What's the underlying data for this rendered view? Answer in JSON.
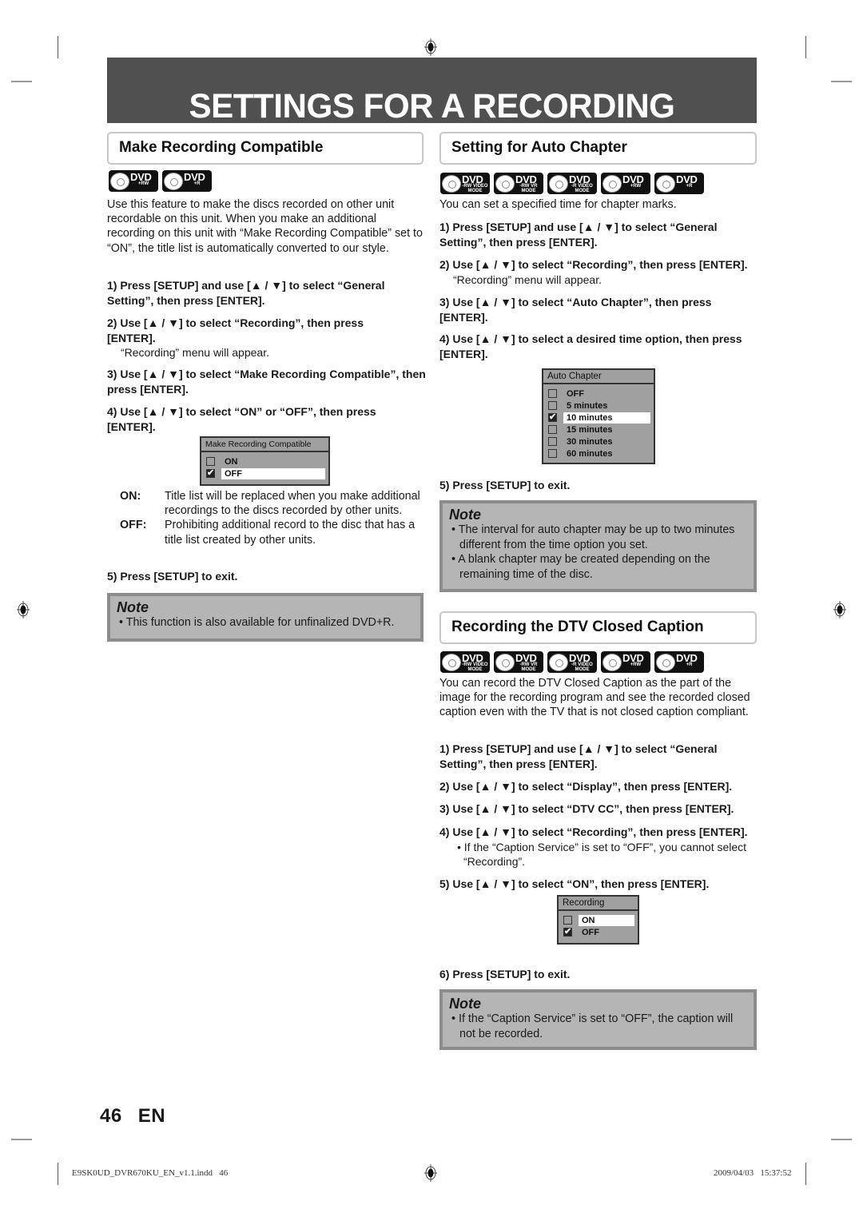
{
  "page": {
    "title": "SETTINGS FOR A RECORDING",
    "page_number": "46",
    "language": "EN"
  },
  "sections": {
    "make_compatible": {
      "heading": "Make Recording Compatible",
      "badges": [
        {
          "label": "DVD",
          "sub": "+RW"
        },
        {
          "label": "DVD",
          "sub": "+R"
        }
      ],
      "intro": "Use this feature to make the discs recorded on other unit recordable on this unit. When you make an additional recording on this unit with “Make Recording Compatible” set to “ON”, the title list is automatically converted to our style.",
      "steps": [
        {
          "num": "1)",
          "text": "Press [SETUP] and use [▲ / ▼] to select “General Setting”, then press [ENTER]."
        },
        {
          "num": "2)",
          "text": "Use [▲ / ▼] to select “Recording”, then press [ENTER].",
          "detail": "“Recording” menu will appear."
        },
        {
          "num": "3)",
          "text": "Use [▲ / ▼] to select “Make Recording Compatible”, then press [ENTER]."
        },
        {
          "num": "4)",
          "text": "Use [▲ / ▼] to select “ON” or “OFF”, then press [ENTER]."
        },
        {
          "num": "5)",
          "text": "Press [SETUP] to exit."
        }
      ],
      "osd": {
        "title": "Make Recording Compatible",
        "options": [
          {
            "label": "ON",
            "checked": false,
            "highlighted": false
          },
          {
            "label": "OFF",
            "checked": true,
            "highlighted": true
          }
        ]
      },
      "definitions": [
        {
          "term": "ON:",
          "desc": "Title list will be replaced when you make additional recordings to the discs recorded by other units."
        },
        {
          "term": "OFF:",
          "desc": "Prohibiting additional record to the disc that has a title list created by other units."
        }
      ],
      "note": {
        "title": "Note",
        "items": [
          "This function is also available for unfinalized DVD+R."
        ]
      }
    },
    "auto_chapter": {
      "heading": "Setting for Auto Chapter",
      "badges": [
        {
          "label": "DVD",
          "sub": "-RW VIDEO MODE"
        },
        {
          "label": "DVD",
          "sub": "-RW VR MODE"
        },
        {
          "label": "DVD",
          "sub": "-R VIDEO MODE"
        },
        {
          "label": "DVD",
          "sub": "+RW"
        },
        {
          "label": "DVD",
          "sub": "+R"
        }
      ],
      "intro": "You can set a specified time for chapter marks.",
      "steps": [
        {
          "num": "1)",
          "text": "Press [SETUP] and use [▲ / ▼] to select “General Setting”, then press [ENTER]."
        },
        {
          "num": "2)",
          "text": "Use [▲ / ▼] to select “Recording”, then press [ENTER].",
          "detail": "“Recording” menu will appear."
        },
        {
          "num": "3)",
          "text": "Use [▲ / ▼] to select “Auto Chapter”, then press [ENTER]."
        },
        {
          "num": "4)",
          "text": "Use [▲ / ▼] to select a desired time option, then press [ENTER]."
        },
        {
          "num": "5)",
          "text": "Press [SETUP] to exit."
        }
      ],
      "osd": {
        "title": "Auto Chapter",
        "options": [
          {
            "label": "OFF",
            "checked": false,
            "highlighted": false
          },
          {
            "label": "5 minutes",
            "checked": false,
            "highlighted": false
          },
          {
            "label": "10 minutes",
            "checked": true,
            "highlighted": true
          },
          {
            "label": "15 minutes",
            "checked": false,
            "highlighted": false
          },
          {
            "label": "30 minutes",
            "checked": false,
            "highlighted": false
          },
          {
            "label": "60 minutes",
            "checked": false,
            "highlighted": false
          }
        ]
      },
      "note": {
        "title": "Note",
        "items": [
          "The interval for auto chapter may be up to two minutes different from the time option you set.",
          "A blank chapter may be created depending on the remaining time of the disc."
        ]
      }
    },
    "dtv_cc": {
      "heading": "Recording the DTV Closed Caption",
      "badges": [
        {
          "label": "DVD",
          "sub": "-RW VIDEO MODE"
        },
        {
          "label": "DVD",
          "sub": "-RW VR MODE"
        },
        {
          "label": "DVD",
          "sub": "-R VIDEO MODE"
        },
        {
          "label": "DVD",
          "sub": "+RW"
        },
        {
          "label": "DVD",
          "sub": "+R"
        }
      ],
      "intro": "You can record the DTV Closed Caption as the part of the image for the recording program and see the recorded closed caption even with the TV that is not closed caption compliant.",
      "steps": [
        {
          "num": "1)",
          "text": "Press [SETUP] and use [▲ / ▼] to select “General Setting”, then press [ENTER]."
        },
        {
          "num": "2)",
          "text": "Use [▲ / ▼] to select “Display”, then press [ENTER]."
        },
        {
          "num": "3)",
          "text": "Use [▲ / ▼] to select “DTV CC”, then press [ENTER]."
        },
        {
          "num": "4)",
          "text": "Use [▲ / ▼] to select “Recording”, then press [ENTER].",
          "bullet": "If the “Caption Service” is set to “OFF”, you cannot select “Recording”."
        },
        {
          "num": "5)",
          "text": "Use [▲ / ▼] to select “ON”, then press [ENTER]."
        },
        {
          "num": "6)",
          "text": "Press [SETUP] to exit."
        }
      ],
      "osd": {
        "title": "Recording",
        "options": [
          {
            "label": "ON",
            "checked": false,
            "highlighted": true
          },
          {
            "label": "OFF",
            "checked": true,
            "highlighted": false
          }
        ]
      },
      "note": {
        "title": "Note",
        "items": [
          "If the “Caption Service” is set to “OFF”, the caption will not be recorded."
        ]
      }
    }
  },
  "footer": {
    "file": "E9SK0UD_DVR670KU_EN_v1.1.indd   46",
    "timestamp": "2009/04/03   15:37:52"
  }
}
